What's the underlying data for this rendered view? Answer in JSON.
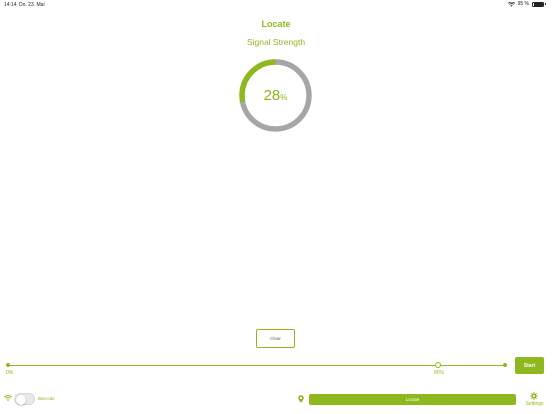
{
  "status_bar": {
    "time": "14:14",
    "date": "Do. 23. Mai",
    "battery": "95 %",
    "wifi_icon": "wifi-icon",
    "battery_icon": "battery-icon"
  },
  "header": {
    "title": "Locate",
    "subtitle": "Signal Strength"
  },
  "gauge": {
    "value": 28,
    "value_text": "28",
    "unit": "%",
    "fill_color": "#8fb81e",
    "track_color": "#a6a6a6"
  },
  "clear_button": {
    "label": "Clear"
  },
  "threshold_slider": {
    "min_label": "0%",
    "value_label": "80%",
    "value": 0.86
  },
  "start_button": {
    "label": "Start"
  },
  "footer": {
    "toggle_label": "Barcode",
    "toggle_on": false,
    "locate_label": "Locate",
    "settings_label": "Settings"
  },
  "colors": {
    "accent": "#8fb81e"
  }
}
